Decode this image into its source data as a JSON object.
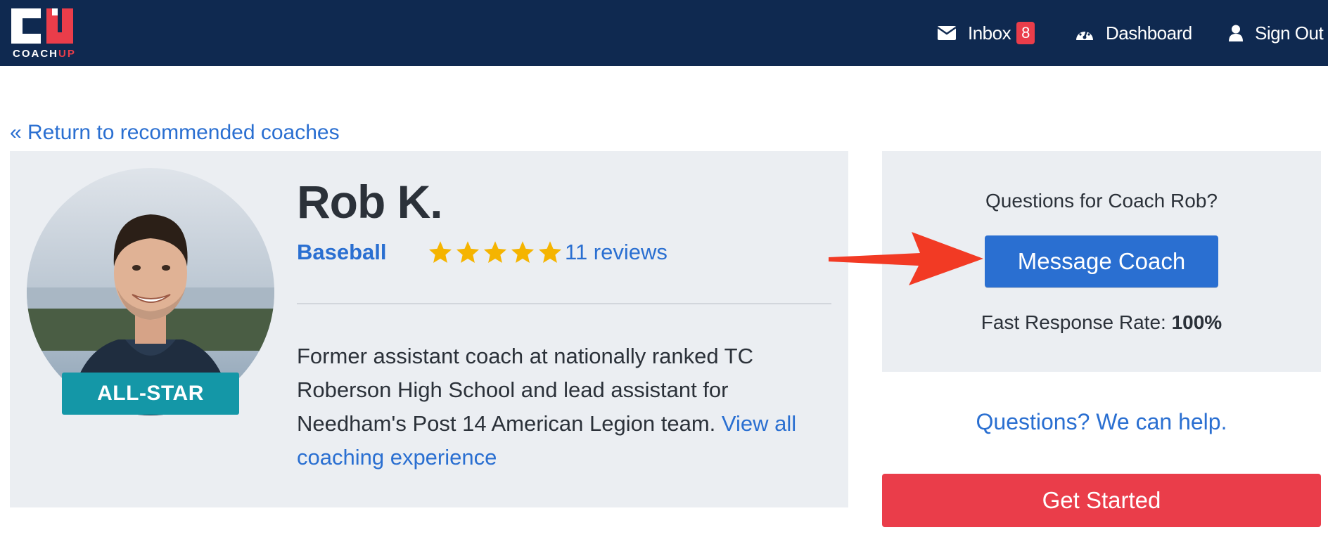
{
  "brand": {
    "logo_letters": "CU",
    "wordmark_a": "COACH",
    "wordmark_b": "UP"
  },
  "nav": {
    "inbox_label": "Inbox",
    "inbox_count": "8",
    "dashboard_label": "Dashboard",
    "signout_label": "Sign Out"
  },
  "return_link": "« Return to recommended coaches",
  "profile": {
    "badge": "ALL-STAR",
    "name": "Rob K.",
    "sport": "Baseball",
    "rating": 5,
    "reviews": "11 reviews",
    "bio": "Former assistant coach at nationally ranked TC Roberson High School and lead assistant for Needham's Post 14 American Legion team.",
    "bio_link": "View all coaching experience"
  },
  "contact": {
    "question": "Questions for Coach Rob?",
    "message_button": "Message Coach",
    "rate_label": "Fast Response Rate: ",
    "rate_value": "100%"
  },
  "help_link": "Questions? We can help.",
  "get_started": "Get Started",
  "colors": {
    "nav_bg": "#0f2950",
    "link_blue": "#2a6fd1",
    "brand_red": "#ea3d4a",
    "badge_teal": "#1497a7",
    "star_gold": "#f5b400",
    "panel_bg": "#ebeef2"
  }
}
